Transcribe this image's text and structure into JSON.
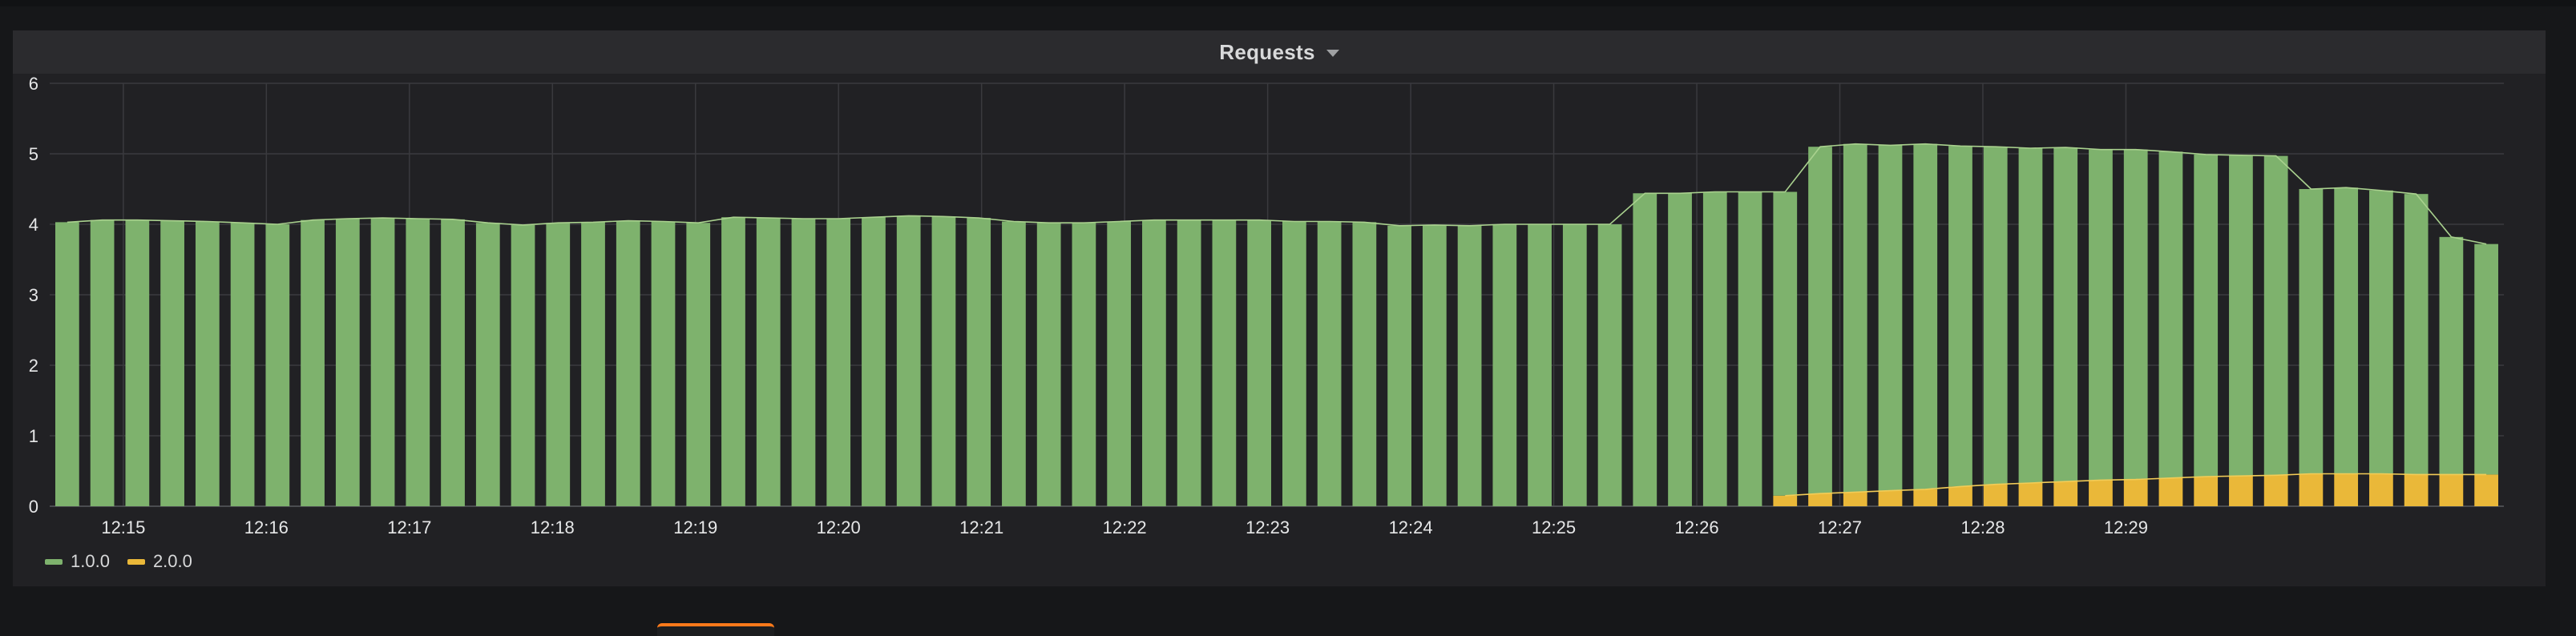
{
  "panel": {
    "title": "Requests"
  },
  "colors": {
    "series_1": "#7eb26d",
    "series_2": "#eab839",
    "grid": "#3a3a3e",
    "axis_text": "#e6e7e8",
    "background": "#212124"
  },
  "chart_data": {
    "type": "bar",
    "stacked": true,
    "title": "Requests",
    "xlabel": "",
    "ylabel": "",
    "ylim": [
      0,
      6
    ],
    "yticks": [
      "0",
      "1",
      "2",
      "3",
      "4",
      "5",
      "6"
    ],
    "xticks": [
      "12:15",
      "12:16",
      "12:17",
      "12:18",
      "12:19",
      "12:20",
      "12:21",
      "12:22",
      "12:23",
      "12:24",
      "12:25",
      "12:26",
      "12:27",
      "12:28",
      "12:29"
    ],
    "grid": true,
    "legend_position": "bottom-left",
    "series": [
      {
        "name": "1.0.0",
        "values": [
          4.03,
          4.06,
          4.06,
          4.05,
          4.04,
          4.02,
          4.0,
          4.06,
          4.08,
          4.09,
          4.08,
          4.07,
          4.02,
          3.99,
          4.02,
          4.03,
          4.05,
          4.04,
          4.02,
          4.1,
          4.09,
          4.08,
          4.08,
          4.1,
          4.12,
          4.11,
          4.09,
          4.04,
          4.02,
          4.02,
          4.04,
          4.06,
          4.06,
          4.06,
          4.06,
          4.04,
          4.04,
          4.03,
          3.98,
          3.99,
          3.98,
          4.0,
          4.0,
          4.0,
          4.0,
          4.44,
          4.44,
          4.46,
          4.46,
          4.31,
          4.92,
          4.94,
          4.9,
          4.9,
          4.83,
          4.79,
          4.75,
          4.74,
          4.69,
          4.68,
          4.63,
          4.57,
          4.55,
          4.53,
          4.04,
          4.06,
          4.02,
          3.98,
          3.37,
          3.27
        ],
        "color": "#7eb26d"
      },
      {
        "name": "2.0.0",
        "values": [
          0,
          0,
          0,
          0,
          0,
          0,
          0,
          0,
          0,
          0,
          0,
          0,
          0,
          0,
          0,
          0,
          0,
          0,
          0,
          0,
          0,
          0,
          0,
          0,
          0,
          0,
          0,
          0,
          0,
          0,
          0,
          0,
          0,
          0,
          0,
          0,
          0,
          0,
          0,
          0,
          0,
          0,
          0,
          0,
          0,
          0,
          0,
          0,
          0,
          0.15,
          0.18,
          0.2,
          0.22,
          0.24,
          0.28,
          0.31,
          0.33,
          0.35,
          0.37,
          0.38,
          0.4,
          0.42,
          0.43,
          0.44,
          0.46,
          0.46,
          0.46,
          0.45,
          0.45,
          0.45
        ],
        "color": "#eab839"
      }
    ]
  }
}
